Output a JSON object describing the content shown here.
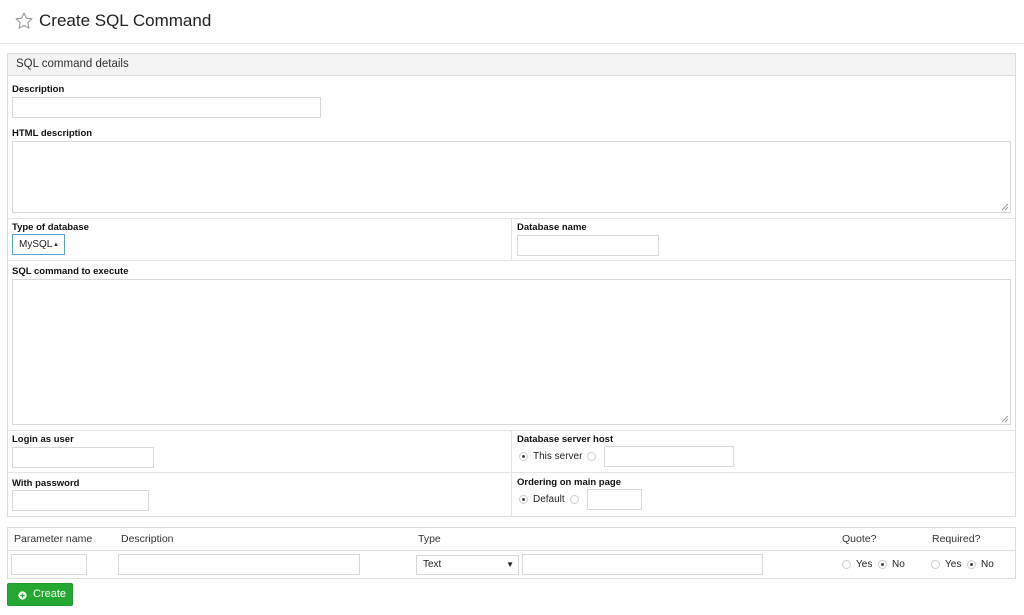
{
  "header": {
    "title": "Create SQL Command",
    "icon": "star-outline-icon"
  },
  "panel": {
    "title": "SQL command details",
    "description": {
      "label": "Description",
      "value": ""
    },
    "html_description": {
      "label": "HTML description",
      "value": ""
    },
    "type_of_database": {
      "label": "Type of database",
      "selected": "MySQL"
    },
    "database_name": {
      "label": "Database name",
      "value": ""
    },
    "sql_command": {
      "label": "SQL command to execute",
      "value": ""
    },
    "login_as_user": {
      "label": "Login as user",
      "value": ""
    },
    "with_password": {
      "label": "With password",
      "value": ""
    },
    "database_server_host": {
      "label": "Database server host",
      "option_this_server": "This server",
      "selected": "This server",
      "other_value": ""
    },
    "ordering": {
      "label": "Ordering on main page",
      "option_default": "Default",
      "selected": "Default",
      "other_value": ""
    }
  },
  "params": {
    "headers": [
      "Parameter name",
      "Description",
      "Type",
      "Quote?",
      "Required?"
    ],
    "row": {
      "name": "",
      "description": "",
      "type": "Text",
      "type_option": "",
      "quote": {
        "yes": "Yes",
        "no": "No",
        "selected": "No"
      },
      "required": {
        "yes": "Yes",
        "no": "No",
        "selected": "No"
      }
    }
  },
  "actions": {
    "create_label": "Create",
    "create_icon": "plus-circle-icon",
    "create_color": "#24a832"
  }
}
